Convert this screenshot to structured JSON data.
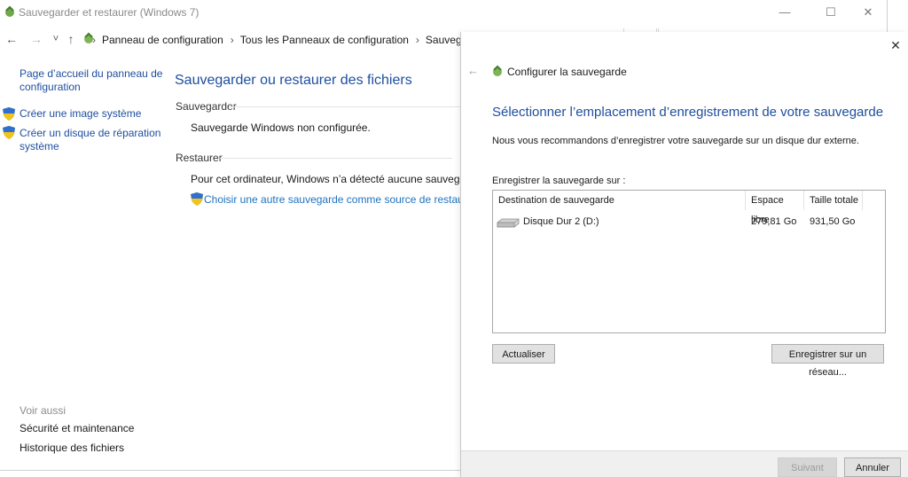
{
  "window": {
    "title": "Sauvegarder et restaurer (Windows 7)",
    "minimize": "—",
    "maximize": "☐",
    "close": "✕"
  },
  "address_bar": {
    "back": "←",
    "forward": "→",
    "recent": "˅",
    "up": "↑",
    "breadcrumbs": [
      "Panneau de configuration",
      "Tous les Panneaux de configuration",
      "Sauvegarder e"
    ],
    "separator": "›"
  },
  "left_pane": {
    "home_link": "Page d’accueil du panneau de configuration",
    "home_link_line1": "Page d’accueil du panneau de",
    "home_link_line2": "configuration",
    "create_image": "Créer une image système",
    "repair_disc_line1": "Créer un disque de réparation",
    "repair_disc_line2": "système",
    "see_also": "Voir aussi",
    "security": "Sécurité et maintenance",
    "file_history": "Historique des fichiers"
  },
  "content": {
    "title": "Sauvegarder ou restaurer des fichiers",
    "backup_header": "Sauvegarder",
    "backup_status": "Sauvegarde Windows non configurée.",
    "restore_header": "Restaurer",
    "restore_status": "Pour cet ordinateur, Windows n’a détecté aucune sauvegarde.",
    "choose_link": "Choisir une autre sauvegarde comme source de restauration d"
  },
  "wizard": {
    "close": "✕",
    "back": "←",
    "title": "Configurer la sauvegarde",
    "heading": "Sélectionner l’emplacement d’enregistrement de votre sauvegarde",
    "recommendation": "Nous vous recommandons d’enregistrer votre sauvegarde sur un disque dur externe.",
    "save_on_label": "Enregistrer la sauvegarde sur :",
    "columns": {
      "destination": "Destination de sauvegarde",
      "free": "Espace libre",
      "total": "Taille totale"
    },
    "rows": [
      {
        "destination": "Disque Dur 2 (D:)",
        "free": "279,81 Go",
        "total": "931,50 Go"
      }
    ],
    "refresh_button": "Actualiser",
    "network_button": "Enregistrer sur un réseau...",
    "next_button": "Suivant",
    "cancel_button": "Annuler"
  },
  "colors": {
    "link": "#1e4e9e",
    "heading": "#1e4e9e",
    "button_bg": "#e1e1e1"
  }
}
